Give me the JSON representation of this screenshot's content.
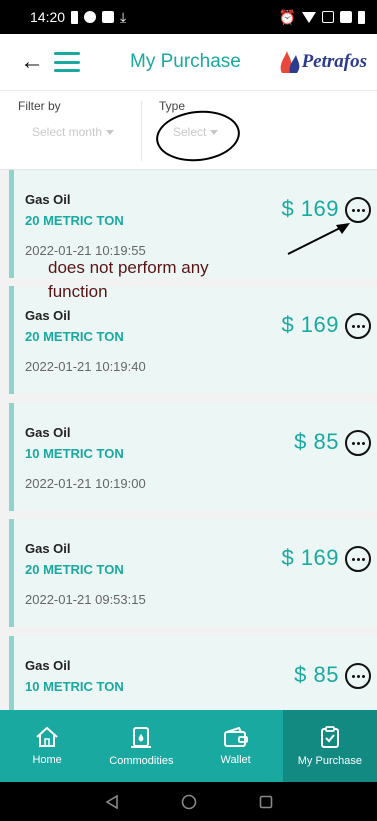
{
  "status_bar": {
    "time": "14:20"
  },
  "header": {
    "title": "My Purchase",
    "brand": "Petrafos"
  },
  "filters": {
    "month": {
      "label": "Filter by",
      "placeholder": "Select month"
    },
    "type": {
      "label": "Type",
      "placeholder": "Select"
    }
  },
  "purchases": [
    {
      "product": "Gas Oil",
      "quantity": "20 METRIC TON",
      "date": "2022-01-21 10:19:55",
      "price": "$ 169"
    },
    {
      "product": "Gas Oil",
      "quantity": "20 METRIC TON",
      "date": "2022-01-21 10:19:40",
      "price": "$ 169"
    },
    {
      "product": "Gas Oil",
      "quantity": "10 METRIC TON",
      "date": "2022-01-21 10:19:00",
      "price": "$ 85"
    },
    {
      "product": "Gas Oil",
      "quantity": "20 METRIC TON",
      "date": "2022-01-21 09:53:15",
      "price": "$ 169"
    },
    {
      "product": "Gas Oil",
      "quantity": "10 METRIC TON",
      "date": "",
      "price": "$ 85"
    }
  ],
  "annotation": {
    "text": "does not perform any function"
  },
  "bottom_nav": [
    {
      "label": "Home",
      "icon": "home-icon"
    },
    {
      "label": "Commodities",
      "icon": "fuel-drum-icon"
    },
    {
      "label": "Wallet",
      "icon": "wallet-icon"
    },
    {
      "label": "My Purchase",
      "icon": "clipboard-check-icon",
      "active": true
    }
  ],
  "colors": {
    "accent": "#1aa9a0",
    "accent_dark": "#128a82",
    "card_highlight": "#ecf7f5",
    "annotation": "#5a1414"
  }
}
